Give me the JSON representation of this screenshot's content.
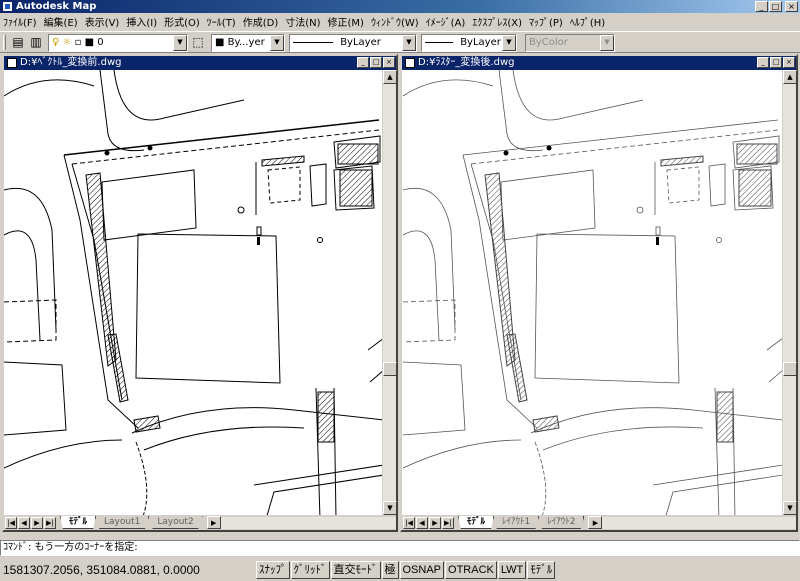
{
  "app": {
    "title": "Autodesk Map"
  },
  "menu": [
    "ﾌｧｲﾙ(F)",
    "編集(E)",
    "表示(V)",
    "挿入(I)",
    "形式(O)",
    "ﾂｰﾙ(T)",
    "作成(D)",
    "寸法(N)",
    "修正(M)",
    "ｳｨﾝﾄﾞｳ(W)",
    "ｲﾒｰｼﾞ(A)",
    "ｴｸｽﾌﾟﾚｽ(X)",
    "ﾏｯﾌﾟ(P)",
    "ﾍﾙﾌﾟ(H)"
  ],
  "toolbar": {
    "layer_value": "0",
    "color_value": "By...yer",
    "linetype_value": "ByLayer",
    "lineweight_value": "ByLayer",
    "plotstyle_value": "ByColor"
  },
  "windows": [
    {
      "title": "D:¥ﾍﾞｸﾄﾙ_変換前.dwg",
      "active": true,
      "tabs": [
        "ﾓﾃﾞﾙ",
        "Layout1",
        "Layout2"
      ]
    },
    {
      "title": "D:¥ﾗｽﾀｰ_変換後.dwg",
      "active": false,
      "tabs": [
        "ﾓﾃﾞﾙ",
        "ﾚｲｱｳﾄ1",
        "ﾚｲｱｳﾄ2"
      ]
    }
  ],
  "command": {
    "prompt": "ｺﾏﾝﾄﾞ: もう一方のｺｰﾅｰを指定:"
  },
  "status": {
    "coords": "1581307.2056, 351084.0881, 0.0000",
    "buttons": [
      "ｽﾅｯﾌﾟ",
      "ｸﾞﾘｯﾄﾞ",
      "直交ﾓｰﾄﾞ",
      "極",
      "OSNAP",
      "OTRACK",
      "LWT",
      "ﾓﾃﾞﾙ"
    ]
  }
}
